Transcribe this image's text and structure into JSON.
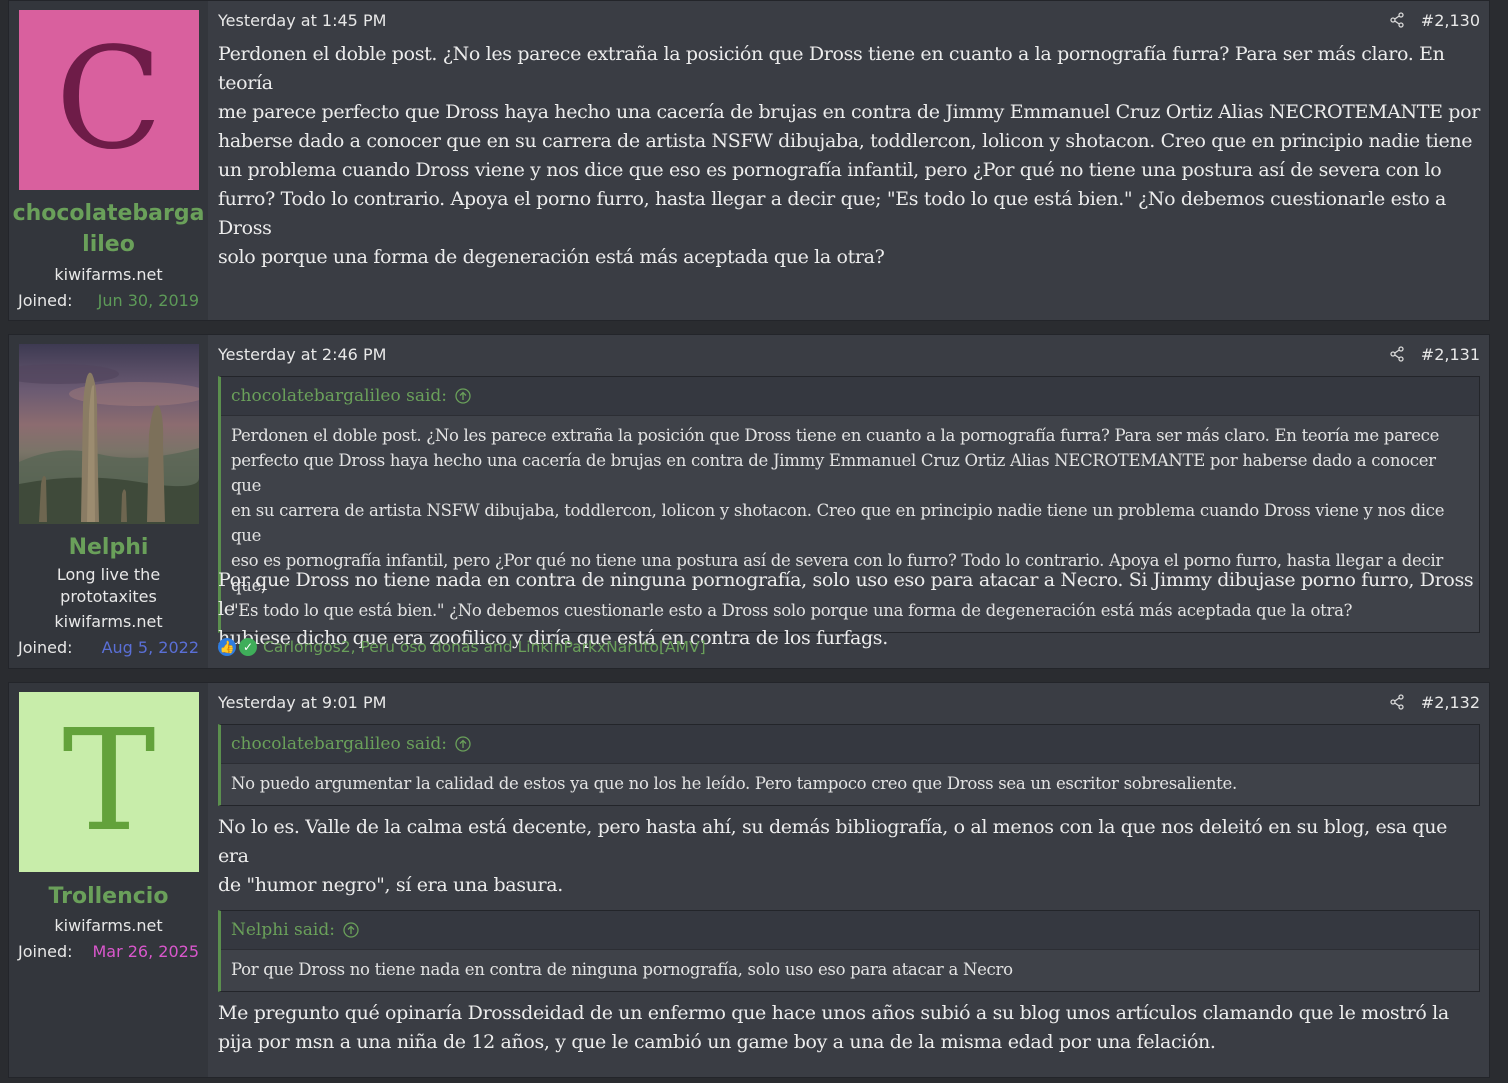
{
  "posts": [
    {
      "avatar_letter": "C",
      "avatar_bg": "#d9609e",
      "avatar_fg": "#6e1c48",
      "username_line1": "chocolatebarga",
      "username_line2": "lileo",
      "site": "kiwifarms.net",
      "joined_label": "Joined:",
      "joined_date": "Jun 30, 2019",
      "joined_color": "#5d9a58",
      "timestamp": "Yesterday at 1:45 PM",
      "post_number": "#2,130",
      "body_lines": [
        "Perdonen el doble post. ¿No les parece extraña la posición que Dross tiene en cuanto a la pornografía furra? Para ser más claro. En teoría",
        "me parece perfecto que Dross haya hecho una cacería de brujas en contra de Jimmy Emmanuel Cruz Ortiz Alias NECROTEMANTE por",
        "haberse dado a conocer que en su carrera de artista NSFW dibujaba, toddlercon, lolicon y shotacon. Creo que en principio nadie tiene",
        "un problema cuando Dross viene y nos dice que eso es pornografía infantil, pero ¿Por qué no tiene una postura así de severa con lo",
        "furro? Todo lo contrario. Apoya el porno furro, hasta llegar a decir que; \"Es todo lo que está bien.\" ¿No debemos cuestionarle esto a Dross",
        "solo porque una forma de degeneración está más aceptada que la otra?"
      ]
    },
    {
      "username": "Nelphi",
      "title_line1": "Long live the",
      "title_line2": "prototaxites",
      "site": "kiwifarms.net",
      "joined_label": "Joined:",
      "joined_date": "Aug 5, 2022",
      "joined_color": "#5a6fd6",
      "timestamp": "Yesterday at 2:46 PM",
      "post_number": "#2,131",
      "quote_author": "chocolatebargalileo said:",
      "quote_lines": [
        "Perdonen el doble post. ¿No les parece extraña la posición que Dross tiene en cuanto a la pornografía furra? Para ser más claro. En teoría me parece",
        "perfecto que Dross haya hecho una cacería de brujas en contra de Jimmy Emmanuel Cruz Ortiz Alias NECROTEMANTE por haberse dado a conocer que",
        "en su carrera de artista NSFW dibujaba, toddlercon, lolicon y shotacon. Creo que en principio nadie tiene un problema cuando Dross viene y nos dice que",
        "eso es pornografía infantil, pero ¿Por qué no tiene una postura así de severa con lo furro? Todo lo contrario. Apoya el porno furro, hasta llegar a decir que;",
        "\"Es todo lo que está bien.\" ¿No debemos cuestionarle esto a Dross solo porque una forma de degeneración está más aceptada que la otra?"
      ],
      "body_lines": [
        "Por que Dross no tiene nada en contra de ninguna pornografía, solo uso eso para atacar a Necro. Si Jimmy dibujase porno furro, Dross le",
        "hubiese dicho que era zoofilico y diría que está en contra de los furfags."
      ],
      "reactions_text": "Carlongos2, Peru oso donas and LinkinParkxNaruto[AMV]"
    },
    {
      "avatar_letter": "T",
      "avatar_bg": "#c8edaa",
      "avatar_fg": "#63a23b",
      "username": "Trollencio",
      "site": "kiwifarms.net",
      "joined_label": "Joined:",
      "joined_date": "Mar 26, 2025",
      "joined_color": "#d957cc",
      "timestamp": "Yesterday at 9:01 PM",
      "post_number": "#2,132",
      "quote1_author": "chocolatebargalileo said:",
      "quote1_text": "No puedo argumentar la calidad de estos ya que no los he leído. Pero tampoco creo que Dross sea un escritor sobresaliente.",
      "body1_lines": [
        "No lo es. Valle de la calma está decente, pero hasta ahí, su demás bibliografía, o al menos con la que nos deleitó en su blog, esa que era",
        "de \"humor negro\", sí era una basura."
      ],
      "quote2_author": "Nelphi said:",
      "quote2_text": "Por que Dross no tiene nada en contra de ninguna pornografía, solo uso eso para atacar a Necro",
      "body2_lines": [
        "Me pregunto qué opinaría Drossdeidad de un enfermo que hace unos años subió a su blog unos artículos clamando que le mostró la",
        "pija por msn a una niña de 12 años, y que le cambió un game boy a una de la misma edad por una felación."
      ]
    }
  ]
}
